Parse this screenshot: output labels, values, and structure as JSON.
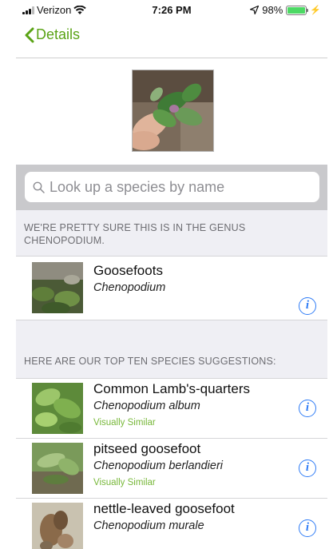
{
  "status_bar": {
    "carrier": "Verizon",
    "time": "7:26 PM",
    "battery": "98%",
    "battery_level": 0.98,
    "icons": [
      "signal-icon",
      "wifi-icon",
      "location-arrow-icon",
      "battery-icon",
      "charging-bolt-icon"
    ]
  },
  "nav": {
    "back_label": "Details"
  },
  "search": {
    "placeholder": "Look up a species by name"
  },
  "genus_section": {
    "header": "WE'RE PRETTY SURE THIS IS IN THE GENUS CHENOPODIUM.",
    "result": {
      "common_name": "Goosefoots",
      "scientific_name": "Chenopodium"
    }
  },
  "species_section": {
    "header": "HERE ARE OUR TOP TEN SPECIES SUGGESTIONS:",
    "items": [
      {
        "common_name": "Common Lamb's-quarters",
        "scientific_name": "Chenopodium album",
        "tag": "Visually Similar"
      },
      {
        "common_name": "pitseed goosefoot",
        "scientific_name": "Chenopodium berlandieri",
        "tag": "Visually Similar"
      },
      {
        "common_name": "nettle-leaved goosefoot",
        "scientific_name": "Chenopodium murale",
        "tag": ""
      }
    ]
  },
  "colors": {
    "accent_green": "#5aa315",
    "tag_green": "#78b83a",
    "info_blue": "#2f7cf6",
    "section_bg": "#efeff4",
    "search_bg": "#c9c9cc"
  }
}
